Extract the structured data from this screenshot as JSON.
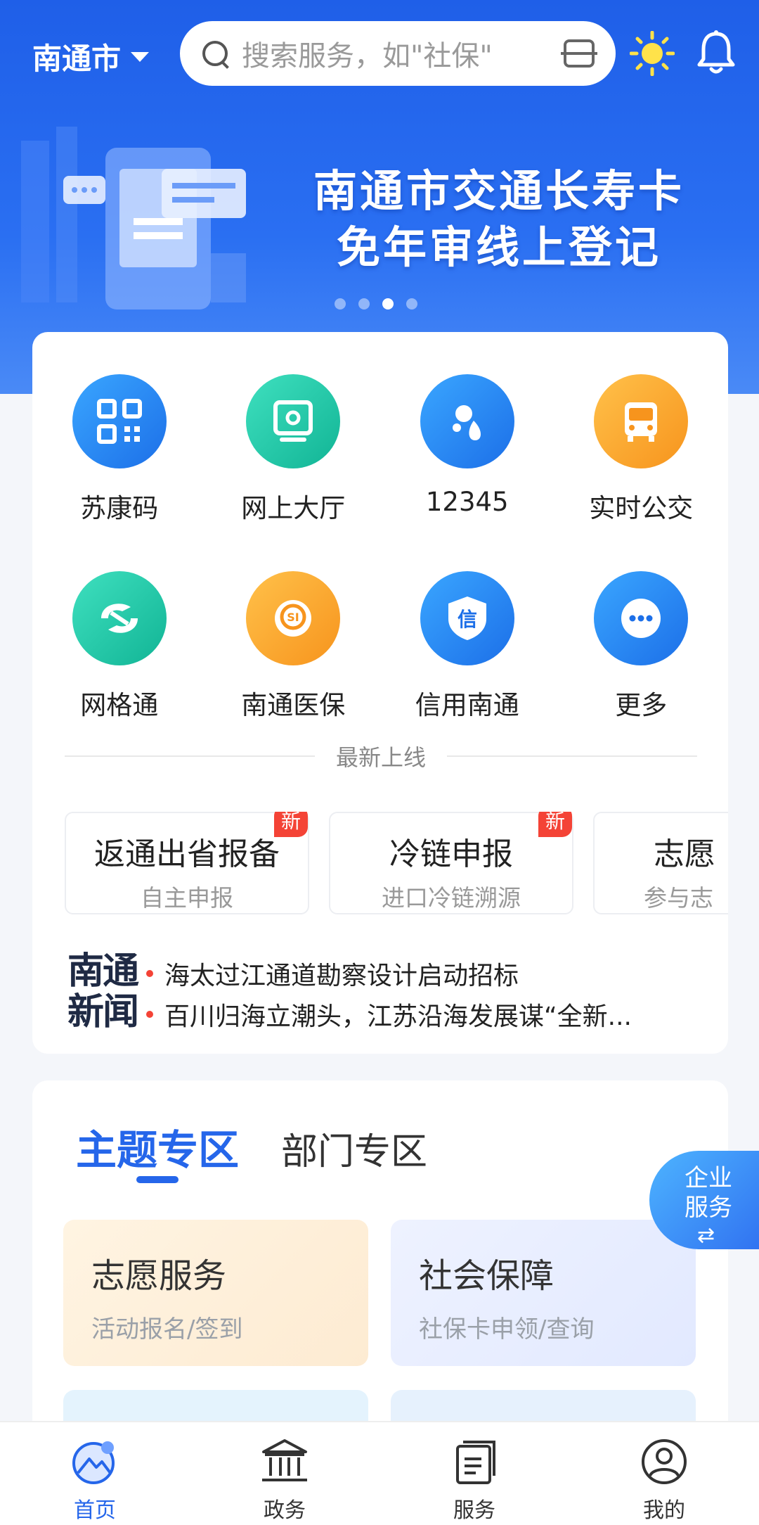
{
  "header": {
    "city": "南通市",
    "search_placeholder": "搜索服务，如\"社保\""
  },
  "banner": {
    "line1": "南通市交通长寿卡",
    "line2": "免年审线上登记",
    "active_dot": 3,
    "dot_count": 4
  },
  "apps": [
    {
      "label": "苏康码",
      "icon": "qr-code-icon",
      "color": "#1c6fe8"
    },
    {
      "label": "网上大厅",
      "icon": "monitor-icon",
      "color": "#11b495"
    },
    {
      "label": "12345",
      "icon": "droplets-icon",
      "color": "#1c6fe8"
    },
    {
      "label": "实时公交",
      "icon": "bus-icon",
      "color": "#f7941d"
    },
    {
      "label": "网格通",
      "icon": "grid-link-icon",
      "color": "#11b495"
    },
    {
      "label": "南通医保",
      "icon": "medical-insurance-icon",
      "color": "#f7941d"
    },
    {
      "label": "信用南通",
      "icon": "credit-shield-icon",
      "color": "#1c6fe8"
    },
    {
      "label": "更多",
      "icon": "more-icon",
      "color": "#1c6fe8"
    }
  ],
  "latest": {
    "title": "最新上线",
    "items": [
      {
        "title": "返通出省报备",
        "sub": "自主申报",
        "badge": "新"
      },
      {
        "title": "冷链申报",
        "sub": "进口冷链溯源",
        "badge": "新"
      },
      {
        "title": "志愿",
        "sub": "参与志"
      }
    ]
  },
  "news": {
    "logo_line1": "南通",
    "logo_line2": "新闻",
    "items": [
      "海太过江通道勘察设计启动招标",
      "百川归海立潮头，江苏沿海发展谋“全新..."
    ]
  },
  "theme": {
    "tabs": [
      "主题专区",
      "部门专区"
    ],
    "active_tab": 0,
    "cards": [
      {
        "title": "志愿服务",
        "sub": "活动报名/签到"
      },
      {
        "title": "社会保障",
        "sub": "社保卡申领/查询"
      }
    ]
  },
  "fab": {
    "line1": "企业",
    "line2": "服务",
    "arrows": "⇄"
  },
  "nav": [
    {
      "label": "首页",
      "icon": "home-icon",
      "active": true
    },
    {
      "label": "政务",
      "icon": "government-icon"
    },
    {
      "label": "服务",
      "icon": "service-doc-icon"
    },
    {
      "label": "我的",
      "icon": "profile-icon"
    }
  ],
  "colors": {
    "primary": "#2566ea",
    "badge": "#f44336"
  }
}
